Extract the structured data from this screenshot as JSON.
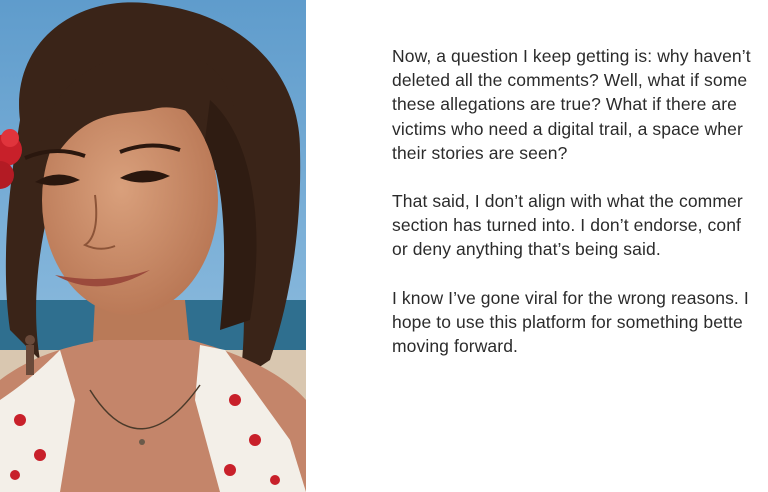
{
  "photo": {
    "subject": "woman-selfie-at-beach",
    "colors": {
      "sky": "#6fa6d3",
      "sea": "#2f6f8f",
      "sand": "#d9c7b0",
      "hair": "#3a2418",
      "skin": "#c98d6c",
      "flower": "#c8202a",
      "top": "#f3efe8"
    }
  },
  "statement": {
    "paragraphs": [
      {
        "lines": [
          "Now, a question I keep getting is: why haven’t",
          "deleted all the comments? Well, what if some",
          "these allegations are true? What if there are",
          "victims who need a digital trail, a space wher",
          "their stories are seen?"
        ]
      },
      {
        "lines": [
          "That said, I don’t align with what the commer",
          "section has turned into. I don’t endorse, conf",
          "or deny anything that’s being said."
        ]
      },
      {
        "lines": [
          "I know I’ve gone viral for the wrong reasons. I",
          "hope to use this platform for something bette",
          "moving forward."
        ]
      }
    ]
  }
}
